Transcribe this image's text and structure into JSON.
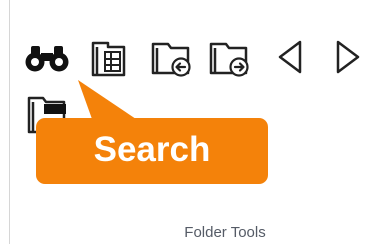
{
  "ribbon_group": {
    "label": "Folder Tools",
    "tools": [
      {
        "name": "search",
        "icon": "binoculars-icon"
      },
      {
        "name": "folder-tree",
        "icon": "folder-tree-icon"
      },
      {
        "name": "folder-back",
        "icon": "folder-back-icon"
      },
      {
        "name": "folder-forward",
        "icon": "folder-forward-icon"
      },
      {
        "name": "previous",
        "icon": "triangle-left-icon"
      },
      {
        "name": "next",
        "icon": "triangle-right-icon"
      },
      {
        "name": "folder-dark",
        "icon": "folder-dark-icon"
      }
    ]
  },
  "tooltip": {
    "text": "Search",
    "color": "#f4820a"
  }
}
